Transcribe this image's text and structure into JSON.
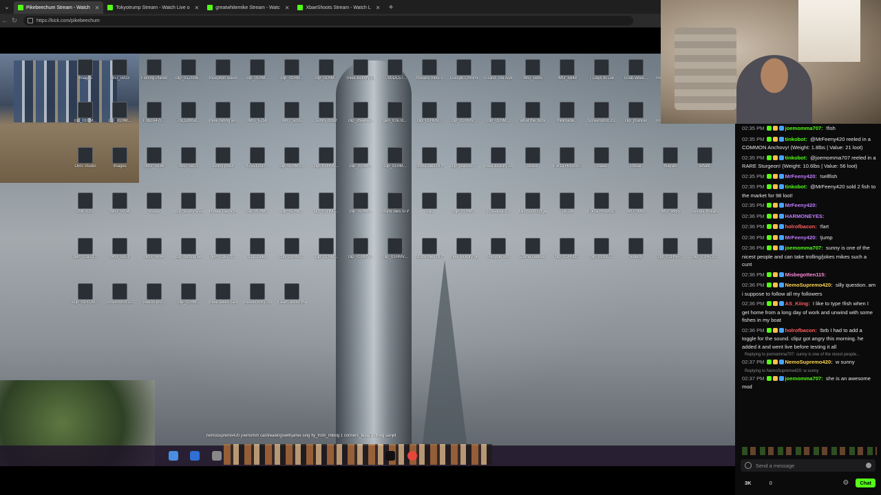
{
  "browser": {
    "tabs": [
      {
        "label": "Pikebeechum Stream - Watch",
        "active": true
      },
      {
        "label": "Tokyotrump Stream - Watch Live o",
        "active": false
      },
      {
        "label": "greatwhitemike Stream - Watc",
        "active": false
      },
      {
        "label": "XbaeShoots Stream - Watch L",
        "active": false
      }
    ],
    "url": "https://kick.com/pikebeechum"
  },
  "desktop": {
    "icons": [
      "Images",
      "IMG_5933",
      "Fishing Planet",
      "clip_01JXN6...",
      "Inception waves 100...",
      "clip_01HM...",
      "clip_01HM...",
      "clip_01HM...",
      "mike kickory Stream - Wa...",
      "0700DC57...",
      "Xbeans mike crab fishing...",
      "Google Chrome",
      "Grand The Auto V",
      "IMG_5985",
      "IMG_5848",
      "7 Days to Die",
      "Grab video...",
      "Recording 2025-03-...",
      "clip_01HM...",
      "clip_01HM...",
      "clip_01HM...",
      "F362A47F...",
      "79CD8058...",
      "mike hiding wod",
      "IMG_5758",
      "IMG_5835",
      "sunny proof",
      "clip_cheese...",
      "gen_01k7d...",
      "clip_01HMV...",
      "clip_01HMV...",
      "clip_01HM...",
      "what the flock",
      "millimade...",
      "Screenshot 2025-11...",
      "clip_prancer",
      "Rockstar Games",
      "Logitech G Accessories",
      "OBS Studio",
      "images",
      "IMG_5936",
      "IMG_5821",
      "sunny proof",
      "b75512f3_...",
      "clip_01HMS...",
      "clip_01HMV...",
      "clip_01HM...",
      "clip_01HM...",
      "Stone dies to Wand e Me...",
      "clip_prancer... - tags etc",
      "mike kickory Stream - Wa...",
      "Brave",
      "Forza Horizon 5",
      "Slave",
      "Inficar",
      "mayahi",
      "whatif",
      "chill_02...",
      "IMG_5934",
      "snaps",
      "clip_sunny snap shak...",
      "Hytale Launcher",
      "clip_01HM...",
      "clip_01HM...",
      "clip_01HMT...",
      "clip_01HM...",
      "Stone dies to Wand e Me...",
      "clip",
      "clip_01HM...",
      "scra-data-fi...",
      "Microsoft Edge",
      "TikTok",
      "Forza Horizon 5",
      "IMG_9960",
      "IMG_9965",
      "Suicide threats (1)",
      "gen_01k7d...",
      "IMG_5951",
      "IMG_5884",
      "clip_botting service",
      "gen_01k7df...",
      "Cop caller",
      "clip_01HN0...",
      "clip_01HM...",
      "clip_01HMV...",
      "clip_01HMV...",
      "Stone dies to Wand e Me...",
      "mike kickory getting a...",
      "Recycle Bin",
      "Zuma Deluxe",
      "clip_01HM1...",
      "clip_01KX7...",
      "videos",
      "clip_01HNA...",
      "clip_01HRS...",
      "clip_01HCM...",
      "Screenshot 2025-11-07...",
      "videos-pro...",
      "clip_01HM...",
      "mike takes care of Free...",
      "mikekickory Stream - Wa...",
      "Learn about this picture"
    ],
    "scroll_names": "nemosupremo420 joemomm cardreadingswithjamie sing fly_from_mibog 1 conners_tesla gothing sanjiit"
  },
  "chat": {
    "messages": [
      {
        "time": "02:35 PM",
        "user": "joemomma707",
        "color": "#53fc18",
        "text": "!fish",
        "reply": ""
      },
      {
        "time": "02:35 PM",
        "user": "tinkobot",
        "color": "#53fc18",
        "text": "@MrFeeny420 reeled in a COMMON Anchovy! (Weight: 1.8lbs | Value: 21 loot)",
        "reply": ""
      },
      {
        "time": "02:35 PM",
        "user": "tinkobot",
        "color": "#53fc18",
        "text": "@joemomma707 reeled in a RARE Sturgeon! (Weight: 10.6lbs | Value: 56 loot)",
        "reply": ""
      },
      {
        "time": "02:35 PM",
        "user": "MrFeeny420",
        "color": "#c17cff",
        "text": "!sellfish",
        "reply": ""
      },
      {
        "time": "02:35 PM",
        "user": "tinkobot",
        "color": "#53fc18",
        "text": "@MrFeeny420 sold 2 fish to the market for 98 loot!",
        "reply": ""
      },
      {
        "time": "02:35 PM",
        "user": "MrFeeny420",
        "color": "#c17cff",
        "text": "",
        "reply": ""
      },
      {
        "time": "02:36 PM",
        "user": "HARMONEYES",
        "color": "#c17cff",
        "text": "",
        "reply": ""
      },
      {
        "time": "02:36 PM",
        "user": "holrofbacon",
        "color": "#ff5d5d",
        "text": "!fart",
        "reply": ""
      },
      {
        "time": "02:36 PM",
        "user": "MrFeeny420",
        "color": "#c17cff",
        "text": "!jump",
        "reply": ""
      },
      {
        "time": "02:36 PM",
        "user": "joemomma707",
        "color": "#53fc18",
        "text": "sunny is one of the nicest people and can take trolling/jokes mikes such a cunt",
        "reply": ""
      },
      {
        "time": "02:36 PM",
        "user": "Misbegotten115",
        "color": "#ff8ad8",
        "text": "",
        "reply": ""
      },
      {
        "time": "02:36 PM",
        "user": "NemoSupremo420",
        "color": "#ffd54f",
        "text": "silly question. am i suppose to follow all my followers",
        "reply": ""
      },
      {
        "time": "02:36 PM",
        "user": "AS_Kiing",
        "color": "#ff5d5d",
        "text": "I like to type !fish when I get home from a long day of work and unwind with some fishes in my boat",
        "reply": ""
      },
      {
        "time": "02:36 PM",
        "user": "holrofbacon",
        "color": "#ff5d5d",
        "text": "!brb I had to add a toggle for the sound. clipz got angry this morning. he added it and went live before testing it all",
        "reply": ""
      },
      {
        "time": "02:37 PM",
        "user": "NemoSupremo420",
        "color": "#ffd54f",
        "text": "w sunny",
        "reply": "Replying to joemomma707: sunny is one of the nicest people..."
      },
      {
        "time": "02:37 PM",
        "user": "joemomma707",
        "color": "#53fc18",
        "text": "she is an awesome mod",
        "reply": "Replying to NemoSupremo420: w sunny"
      }
    ],
    "send_placeholder": "Send a message",
    "viewer_count": "3K",
    "zero_count": "0",
    "chat_button": "Chat"
  }
}
